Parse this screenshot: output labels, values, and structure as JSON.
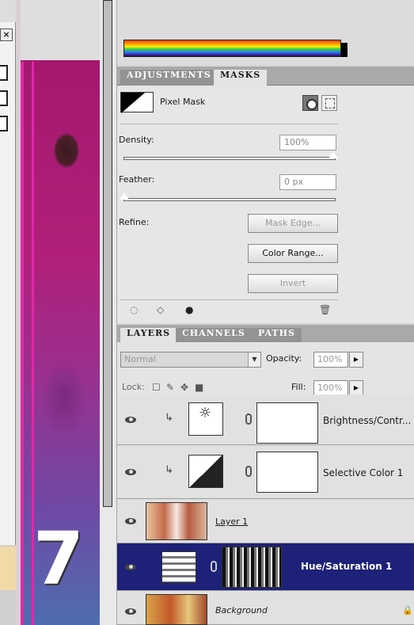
{
  "adjustments_panel": {
    "tabs": [
      "ADJUSTMENTS",
      "MASKS"
    ],
    "active_tab": "MASKS",
    "mask_label": "Pixel Mask",
    "density_label": "Density:",
    "density_value": "100%",
    "density_slider_fraction": 1.0,
    "feather_label": "Feather:",
    "feather_value": "0 px",
    "feather_slider_fraction": 0.0,
    "refine_label": "Refine:",
    "mask_edge_button": "Mask Edge...",
    "color_range_button": "Color Range...",
    "invert_button": "Invert"
  },
  "layers_panel": {
    "tabs": [
      "LAYERS",
      "CHANNELS",
      "PATHS"
    ],
    "active_tab": "LAYERS",
    "blend_mode": "Normal",
    "opacity_label": "Opacity:",
    "opacity_value": "100%",
    "lock_label": "Lock:",
    "fill_label": "Fill:",
    "fill_value": "100%",
    "layers": [
      {
        "name": "Brightness/Contr...",
        "kind": "adjustment",
        "selected": false
      },
      {
        "name": "Selective Color 1",
        "kind": "adjustment",
        "selected": false
      },
      {
        "name": "Layer 1",
        "kind": "pixel",
        "selected": false
      },
      {
        "name": "Hue/Saturation 1",
        "kind": "adjustment",
        "selected": true
      },
      {
        "name": "Background",
        "kind": "pixel",
        "selected": false
      }
    ]
  },
  "canvas": {
    "step_number": "7"
  },
  "dialog": {
    "close_glyph": "×"
  },
  "colors": {
    "selected_layer": "#1d2178",
    "accent_magenta": "#e028a8"
  }
}
